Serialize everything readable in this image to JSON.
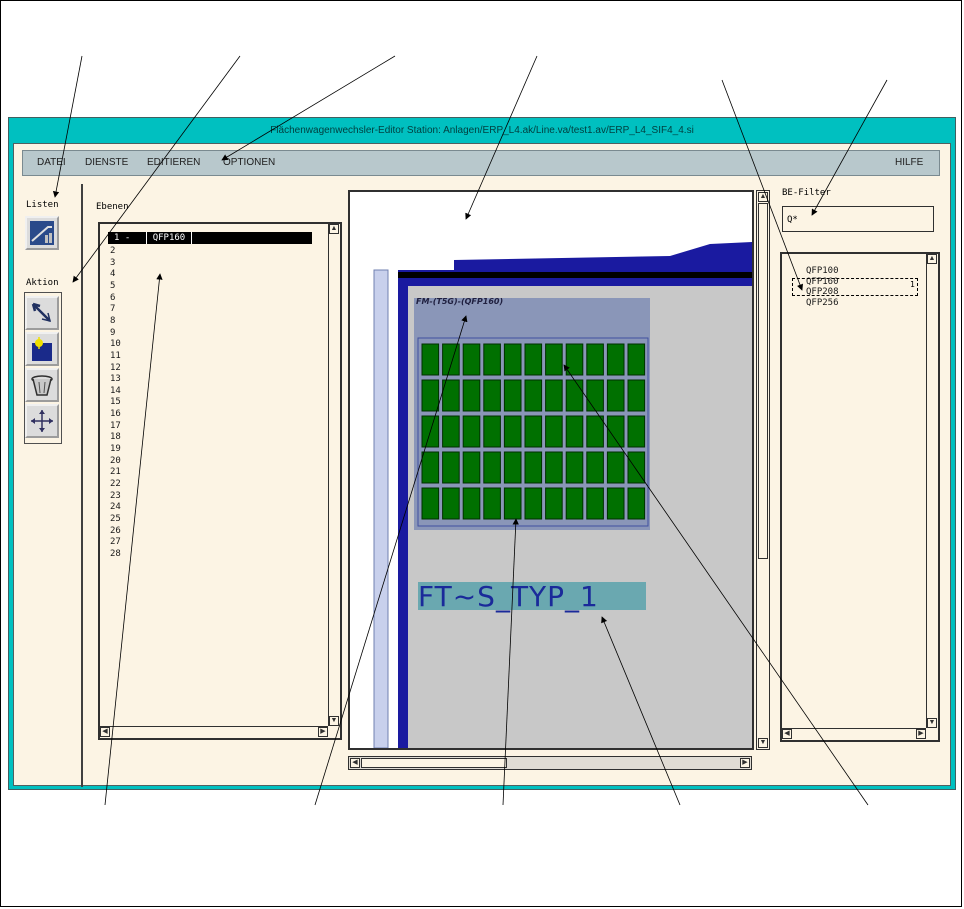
{
  "window": {
    "title": "Flächenwagenwechsler-Editor     Station:  Anlagen/ERP_L4.ak/Line.va/test1.av/ERP_L4_SIF4_4.si"
  },
  "menu": {
    "datei": "DATEI",
    "dienste": "DIENSTE",
    "editieren": "EDITIEREN",
    "optionen": "OPTIONEN",
    "hilfe": "HILFE"
  },
  "sidebar": {
    "listen_label": "Listen",
    "aktion_label": "Aktion"
  },
  "tools": {
    "listen": "list-tool-icon",
    "select": "pointer-arrow-icon",
    "place": "place-element-icon",
    "delete": "trash-bin-icon",
    "move": "move-cross-icon"
  },
  "layers": {
    "header": "Ebenen",
    "selected_number": "1 -",
    "selected_name": "QFP160",
    "rows": [
      "2",
      "3",
      "4",
      "5",
      "6",
      "7",
      "8",
      "9",
      "10",
      "11",
      "12",
      "13",
      "14",
      "15",
      "16",
      "17",
      "18",
      "19",
      "20",
      "21",
      "22",
      "23",
      "24",
      "25",
      "26",
      "27",
      "28"
    ]
  },
  "canvas": {
    "component_label": "FM-(T5G)-(QFP160)",
    "type_label": "FT~S_TYP_1",
    "grid": {
      "rows": 5,
      "columns": 11
    },
    "colors": {
      "cell": "#007000",
      "cell_border": "#003000",
      "component_bg": "#8a96b8",
      "dark_blue": "#1a1aa0"
    }
  },
  "filter": {
    "label": "BE-Filter",
    "value": "Q*"
  },
  "be_list": {
    "items": [
      "QFP100",
      "QFP160",
      "QFP208",
      "QFP256"
    ],
    "marker": "1"
  }
}
